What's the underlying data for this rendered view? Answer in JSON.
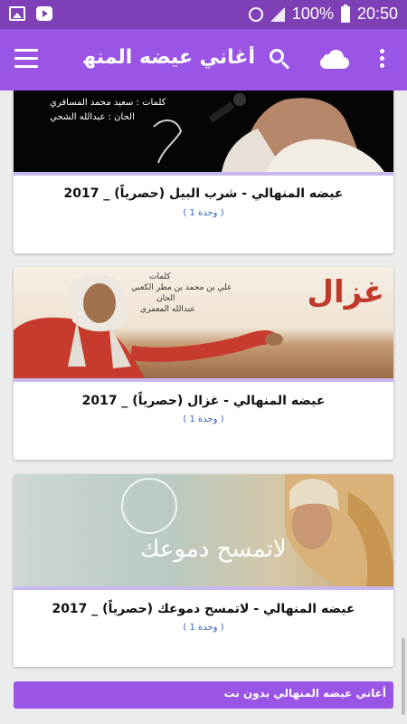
{
  "status_bar": {
    "battery": "100%",
    "time": "20:50"
  },
  "app_bar": {
    "title": "أغاني عيضه المنها..."
  },
  "cards": [
    {
      "title": "عيضه المنهالي - شرب البيل (حصرياً) _ 2017",
      "subtitle": "( 1 وحدة )",
      "thumb_text": [
        "كلمات   :   سعيد محمد المسافري",
        "الحان    :   عبدالله الشحي"
      ]
    },
    {
      "title": "عيضه المنهالي - غزال (حصرياً) _ 2017",
      "subtitle": "( 1 وحدة )",
      "thumb_text": [
        "غزال",
        "كلمات",
        "علي بن محمد بن مطر الكعبي",
        "الحان",
        "عبدالله المعمري"
      ]
    },
    {
      "title": "عيضه المنهالي - لاتمسح دموعك (حصرياً) _ 2017",
      "subtitle": "( 1 وحدة )",
      "thumb_text": [
        "لاتمسح دموعك"
      ]
    }
  ],
  "banner": {
    "text": "أغاني عيضه المنهالي بدون نت"
  },
  "colors": {
    "status_bar": "#7e3fb7",
    "app_bar": "#9a54e6",
    "subtitle": "#2e63c4"
  },
  "icons": [
    "image-icon",
    "youtube-icon",
    "alarm-icon",
    "signal-icon",
    "battery-icon",
    "menu-icon",
    "search-icon",
    "cloud-icon",
    "more-vert-icon"
  ]
}
